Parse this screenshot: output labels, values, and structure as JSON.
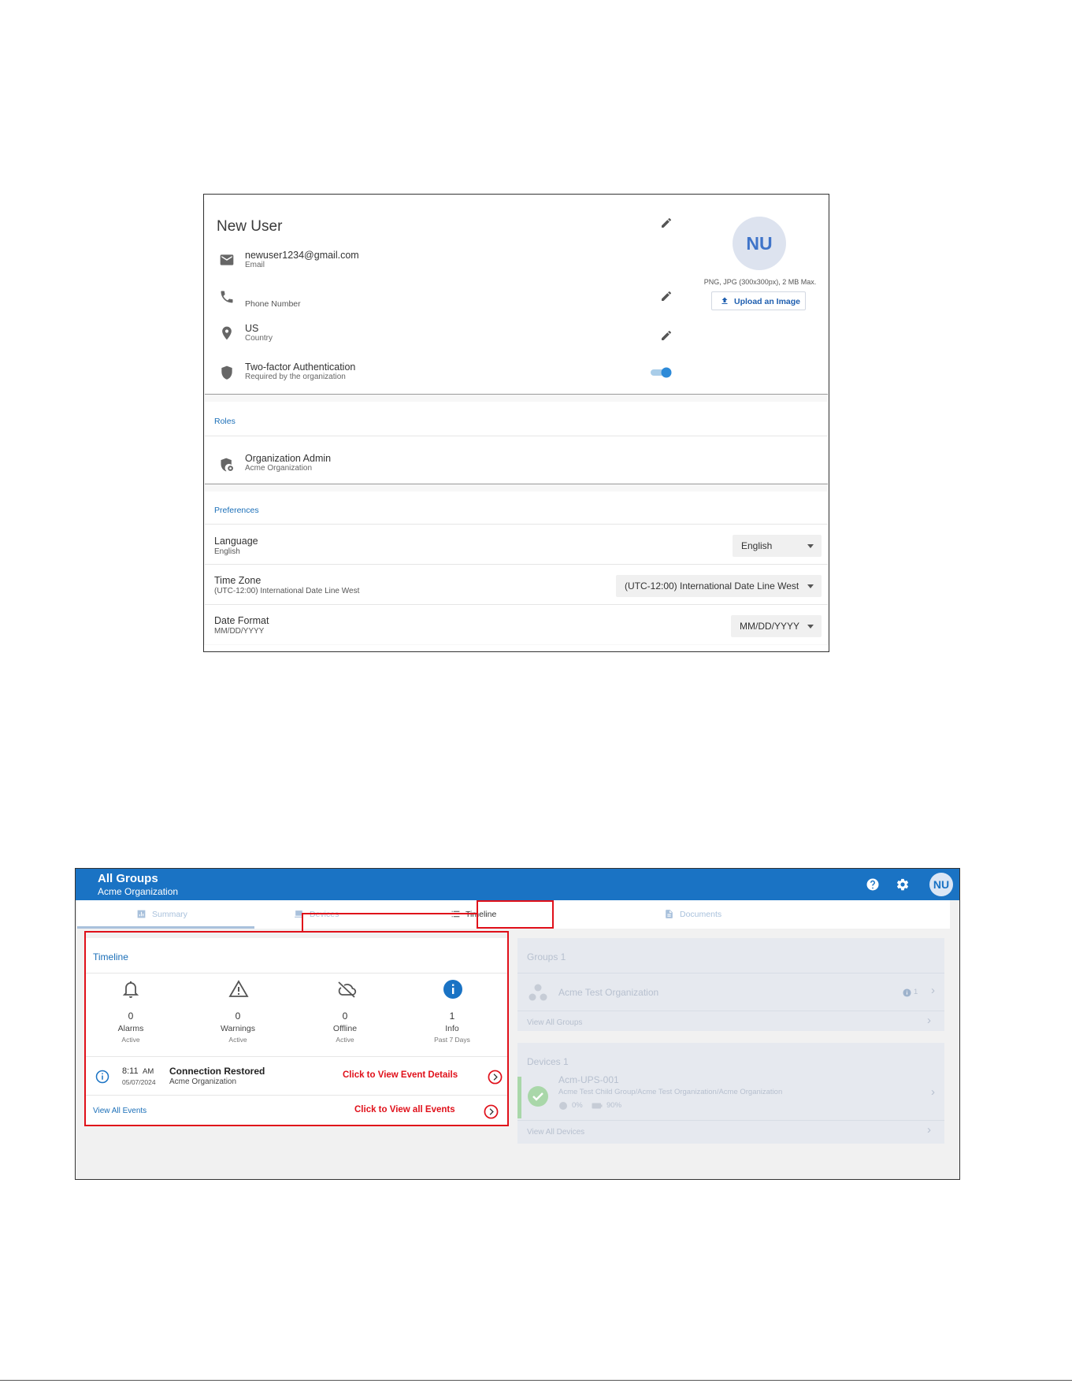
{
  "profile": {
    "name": "New User",
    "email": "newuser1234@gmail.com",
    "email_label": "Email",
    "phone_label": "Phone Number",
    "country": "US",
    "country_label": "Country",
    "tfa_title": "Two-factor Authentication",
    "tfa_sub": "Required by the organization",
    "tfa_enabled": true,
    "avatar_initials": "NU",
    "image_note": "PNG, JPG (300x300px), 2 MB Max.",
    "upload_label": "Upload an Image"
  },
  "roles": {
    "title": "Roles",
    "items": [
      {
        "name": "Organization Admin",
        "org": "Acme Organization"
      }
    ]
  },
  "preferences": {
    "title": "Preferences",
    "language": {
      "label": "Language",
      "value": "English",
      "selected": "English"
    },
    "timezone": {
      "label": "Time Zone",
      "value": "(UTC-12:00) International Date Line West",
      "selected": "(UTC-12:00) International Date Line West"
    },
    "date_format": {
      "label": "Date Format",
      "value": "MM/DD/YYYY",
      "selected": "MM/DD/YYYY"
    }
  },
  "dashboard": {
    "title": "All Groups",
    "subtitle": "Acme Organization",
    "avatar_initials": "NU",
    "tabs": [
      "Summary",
      "Devices",
      "Timeline",
      "Documents"
    ],
    "timeline": {
      "title": "Timeline",
      "stats": [
        {
          "count": "0",
          "label": "Alarms",
          "sub": "Active"
        },
        {
          "count": "0",
          "label": "Warnings",
          "sub": "Active"
        },
        {
          "count": "0",
          "label": "Offline",
          "sub": "Active"
        },
        {
          "count": "1",
          "label": "Info",
          "sub": "Past 7 Days"
        }
      ],
      "event": {
        "time": "8:11",
        "ampm": "AM",
        "date": "05/07/2024",
        "title": "Connection Restored",
        "org": "Acme Organization"
      },
      "view_all": "View All Events"
    },
    "groups": {
      "title": "Groups 1",
      "item": "Acme Test Organization",
      "badge_count": "1",
      "view_all": "View All Groups"
    },
    "devices": {
      "title": "Devices 1",
      "name": "Acm-UPS-001",
      "path": "Acme Test Child Group/Acme Test Organization/Acme Organization",
      "load": "0%",
      "battery": "90%",
      "view_all": "View All Devices"
    },
    "annotations": {
      "event_details": "Click to View Event Details",
      "all_events": "Click to View all Events"
    }
  }
}
